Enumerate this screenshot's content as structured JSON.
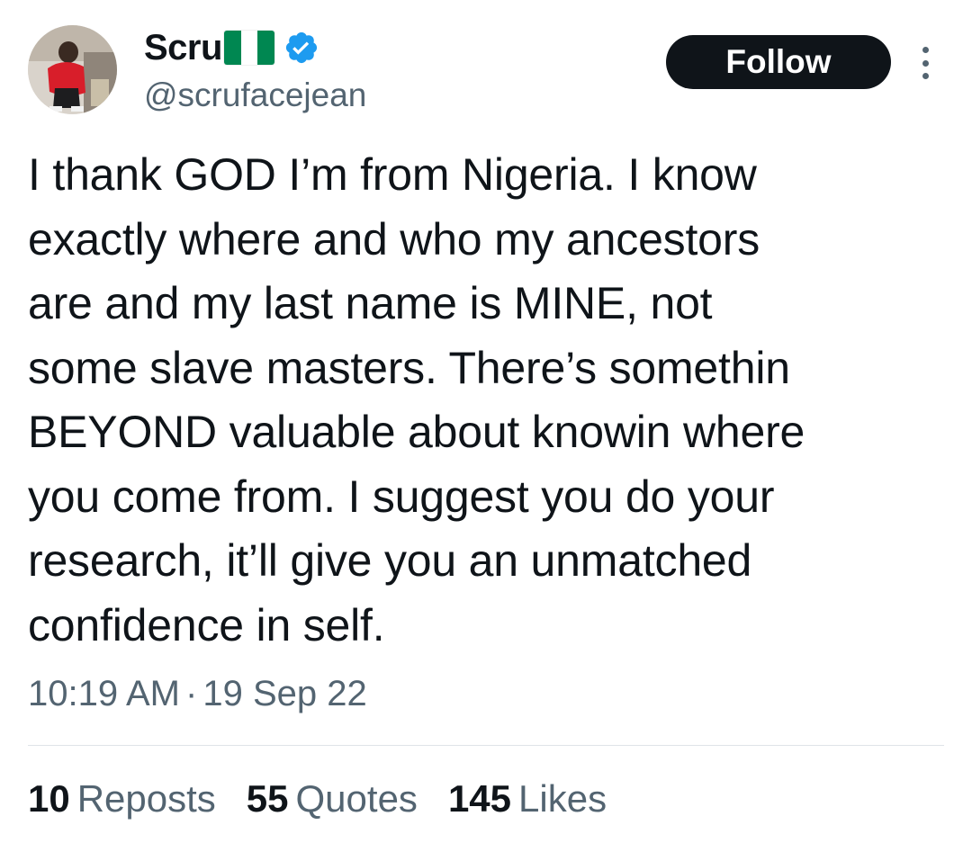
{
  "author": {
    "display_name": "Scru",
    "handle": "@scrufacejean",
    "flag": "nigeria-flag",
    "verified_badge": "verified-badge-icon",
    "colors": {
      "flag_green": "#008751",
      "flag_white": "#ffffff",
      "verified_blue": "#1d9bf0"
    }
  },
  "actions": {
    "follow_label": "Follow",
    "more_icon": "more-vertical-icon"
  },
  "tweet": {
    "lines": [
      "I thank GOD I’m from Nigeria. I know",
      "exactly where and who my ancestors",
      "are and my last name is MINE, not",
      "some slave masters. There’s somethin",
      "BEYOND valuable about knowin where",
      "you come from. I suggest you do your",
      "research, it’ll give you an unmatched",
      "confidence in self."
    ],
    "time": "10:19 AM",
    "separator": "·",
    "date": "19 Sep 22"
  },
  "stats": {
    "reposts": {
      "count": "10",
      "label": "Reposts"
    },
    "quotes": {
      "count": "55",
      "label": "Quotes"
    },
    "likes": {
      "count": "145",
      "label": "Likes"
    }
  },
  "theme": {
    "text_primary": "#0f1419",
    "text_secondary": "#536471",
    "button_bg": "#0f1419",
    "divider": "#dfe4e8"
  }
}
